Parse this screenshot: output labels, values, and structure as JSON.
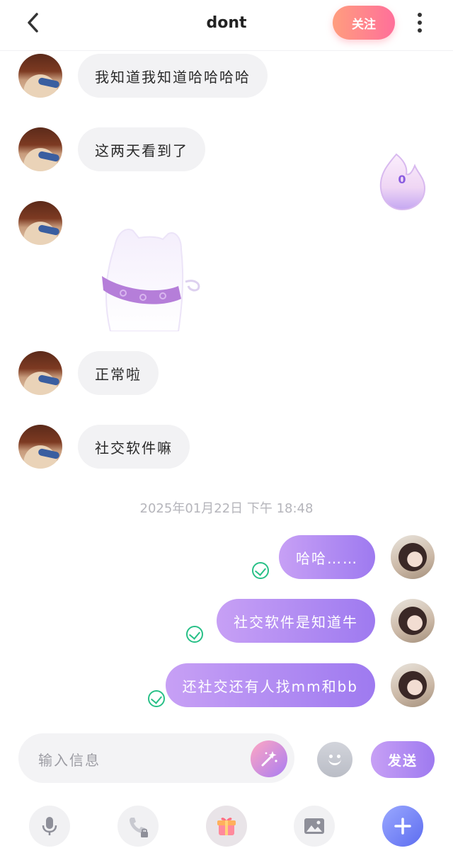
{
  "header": {
    "title": "dont",
    "follow_label": "关注"
  },
  "chat": {
    "incoming": [
      {
        "text": "我知道我知道哈哈哈哈"
      },
      {
        "text": "这两天看到了"
      },
      {
        "text": "正常啦"
      },
      {
        "text": "社交软件嘛"
      }
    ],
    "timestamp": "2025年01月22日 下午 18:48",
    "outgoing": [
      {
        "text": "哈哈……"
      },
      {
        "text": "社交软件是知道牛"
      },
      {
        "text": "还社交还有人找mm和bb"
      }
    ],
    "flame_count": "0"
  },
  "input": {
    "placeholder": "输入信息",
    "send_label": "发送"
  },
  "icons": {
    "back": "chevron-left-icon",
    "more": "more-vertical-icon",
    "magic": "magic-wand-icon",
    "emoji": "emoji-icon",
    "mic": "microphone-icon",
    "phone": "phone-locked-icon",
    "gift": "gift-icon",
    "image": "image-icon",
    "plus": "plus-icon"
  },
  "colors": {
    "accent_purple": "#9e7af0",
    "follow_gradient_start": "#ff9d7e",
    "follow_gradient_end": "#ff6f9a",
    "read_check": "#28c087"
  }
}
